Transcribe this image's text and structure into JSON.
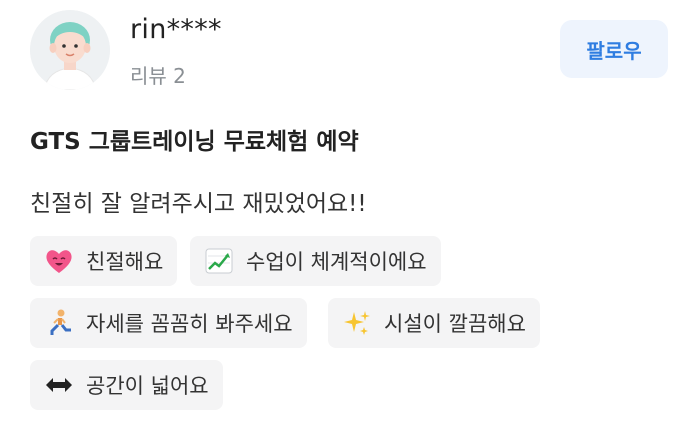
{
  "user": {
    "name": "rin****",
    "review_count": "리뷰 2",
    "follow_label": "팔로우"
  },
  "review": {
    "title": "GTS 그룹트레이닝 무료체험 예약",
    "text": "친절히 잘 알려주시고 재밌었어요!!"
  },
  "tags": [
    {
      "label": "친절해요",
      "icon": "heart-face-icon"
    },
    {
      "label": "수업이 체계적이에요",
      "icon": "chart-up-icon"
    },
    {
      "label": "자세를 꼼꼼히 봐주세요",
      "icon": "lunge-person-icon"
    },
    {
      "label": "시설이 깔끔해요",
      "icon": "sparkles-icon"
    },
    {
      "label": "공간이 넓어요",
      "icon": "left-right-arrow-icon"
    }
  ],
  "colors": {
    "accent": "#2f7de1",
    "follow_bg": "#eef4fd",
    "tag_bg": "#f4f4f5",
    "muted_text": "#8a8f94"
  }
}
